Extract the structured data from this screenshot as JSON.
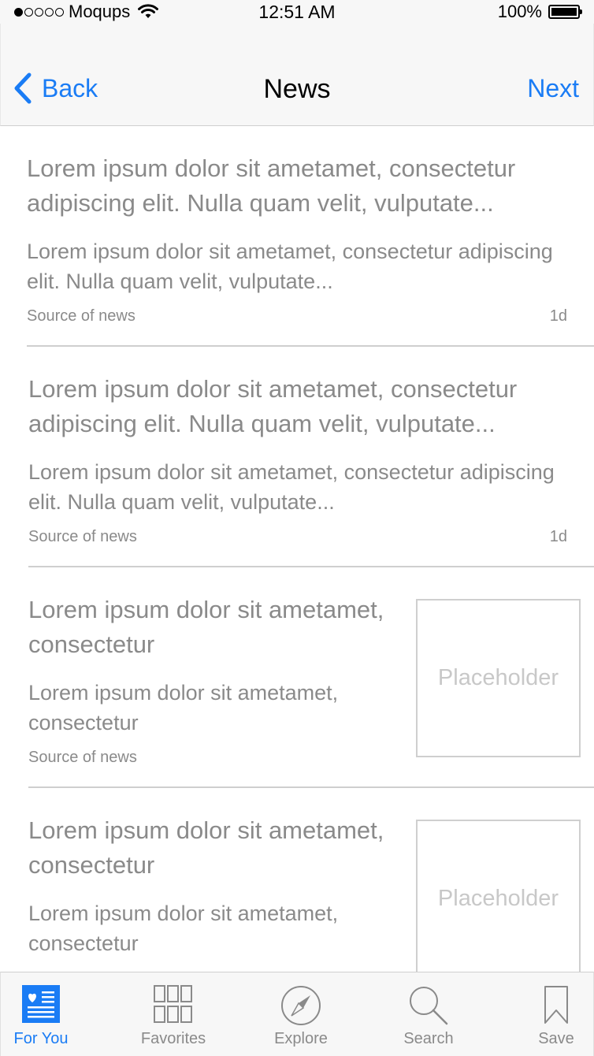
{
  "status_bar": {
    "carrier": "Moqups",
    "time": "12:51 AM",
    "battery": "100%",
    "battery_level": 1.0
  },
  "nav": {
    "back_label": "Back",
    "title": "News",
    "next_label": "Next"
  },
  "news": [
    {
      "headline": "Lorem ipsum dolor sit ametamet, consectetur adipiscing elit. Nulla quam velit, vulputate...",
      "summary": "Lorem ipsum dolor sit ametamet, consectetur adipiscing elit. Nulla quam velit, vulputate...",
      "source": "Source of news",
      "age": "1d"
    },
    {
      "headline": "Lorem ipsum dolor sit ametamet, consectetur adipiscing elit. Nulla quam velit, vulputate...",
      "summary": "Lorem ipsum dolor sit ametamet, consectetur adipiscing elit. Nulla quam velit, vulputate...",
      "source": "Source of news",
      "age": "1d"
    },
    {
      "headline": "Lorem ipsum dolor sit ametamet, consectetur",
      "summary": "Lorem ipsum dolor sit ametamet, consectetur",
      "source": "Source of news",
      "image_label": "Placeholder"
    },
    {
      "headline": "Lorem ipsum dolor sit ametamet, consectetur",
      "summary": "Lorem ipsum dolor sit ametamet, consectetur",
      "image_label": "Placeholder"
    }
  ],
  "tabs": [
    {
      "label": "For You",
      "icon": "newspaper-heart-icon",
      "active": true
    },
    {
      "label": "Favorites",
      "icon": "grid-icon",
      "active": false
    },
    {
      "label": "Explore",
      "icon": "compass-icon",
      "active": false
    },
    {
      "label": "Search",
      "icon": "search-icon",
      "active": false
    },
    {
      "label": "Save",
      "icon": "bookmark-icon",
      "active": false
    }
  ],
  "colors": {
    "accent": "#1a7cf5",
    "text_gray": "#8a8a8a",
    "placeholder_gray": "#c8c8c8",
    "bar_bg": "#f7f7f7",
    "divider": "#cfcfcf"
  }
}
